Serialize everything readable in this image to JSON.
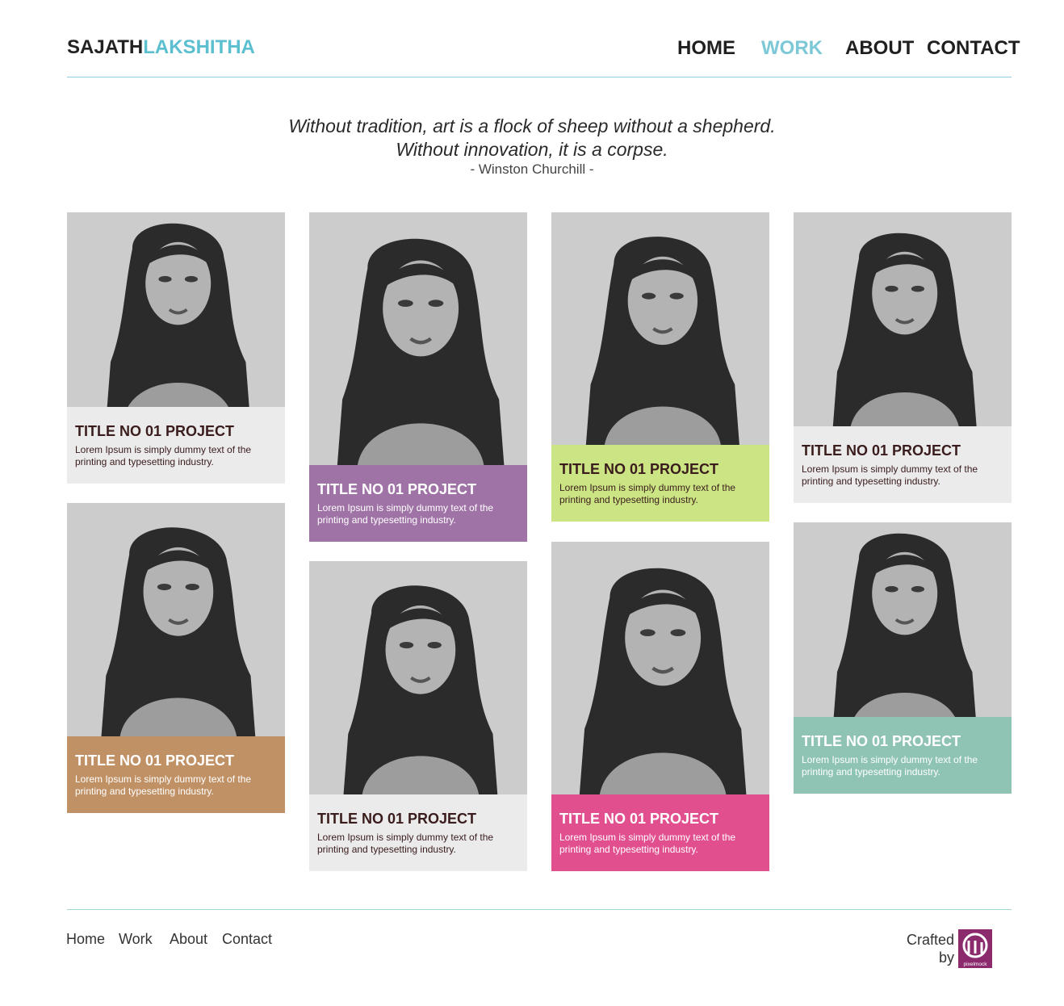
{
  "brand": {
    "first": "SAJATH",
    "second": "LAKSHITHA"
  },
  "nav": [
    "HOME",
    "WORK",
    "ABOUT",
    "CONTACT"
  ],
  "quote": {
    "line1": "Without tradition, art is a flock of sheep without a shepherd.",
    "line2": "Without innovation, it is a corpse.",
    "author": "- Winston Churchill -"
  },
  "colors": {
    "accent": "#5bbfd0",
    "card_grey": "#ebebeb",
    "card_purple": "#a073a7",
    "card_green": "#cce584",
    "card_brown": "#c19166",
    "card_pink": "#e14f8f",
    "card_teal": "#8fc4b5"
  },
  "cards": [
    {
      "title": "TITLE NO 01 PROJECT",
      "desc": "Lorem Ipsum is simply dummy text of the printing and typesetting industry.",
      "image": "portrait-sketch"
    },
    {
      "title": "TITLE NO 01 PROJECT",
      "desc": "Lorem Ipsum is simply dummy text of the printing and typesetting industry.",
      "image": "portrait-sketch"
    },
    {
      "title": "TITLE NO 01 PROJECT",
      "desc": "Lorem Ipsum is simply dummy text of the printing and typesetting industry.",
      "image": "portrait-sketch"
    },
    {
      "title": "TITLE NO 01 PROJECT",
      "desc": "Lorem Ipsum is simply dummy text of the printing and typesetting industry.",
      "image": "portrait-sketch"
    },
    {
      "title": "TITLE NO 01 PROJECT",
      "desc": "Lorem Ipsum is simply dummy text of the printing and typesetting industry.",
      "image": "portrait-sketch"
    },
    {
      "title": "TITLE NO 01 PROJECT",
      "desc": "Lorem Ipsum is simply dummy text of the printing and typesetting industry.",
      "image": "portrait-sketch"
    },
    {
      "title": "TITLE NO 01 PROJECT",
      "desc": "Lorem Ipsum is simply dummy text of the printing and typesetting industry.",
      "image": "portrait-sketch"
    },
    {
      "title": "TITLE NO 01 PROJECT",
      "desc": "Lorem Ipsum is simply dummy text of the printing and typesetting industry.",
      "image": "portrait-sketch"
    }
  ],
  "footer": {
    "links": [
      "Home",
      "Work",
      "About",
      "Contact"
    ],
    "crafted_line1": "Crafted",
    "crafted_line2": "by",
    "logo_text": "pixelmock"
  }
}
